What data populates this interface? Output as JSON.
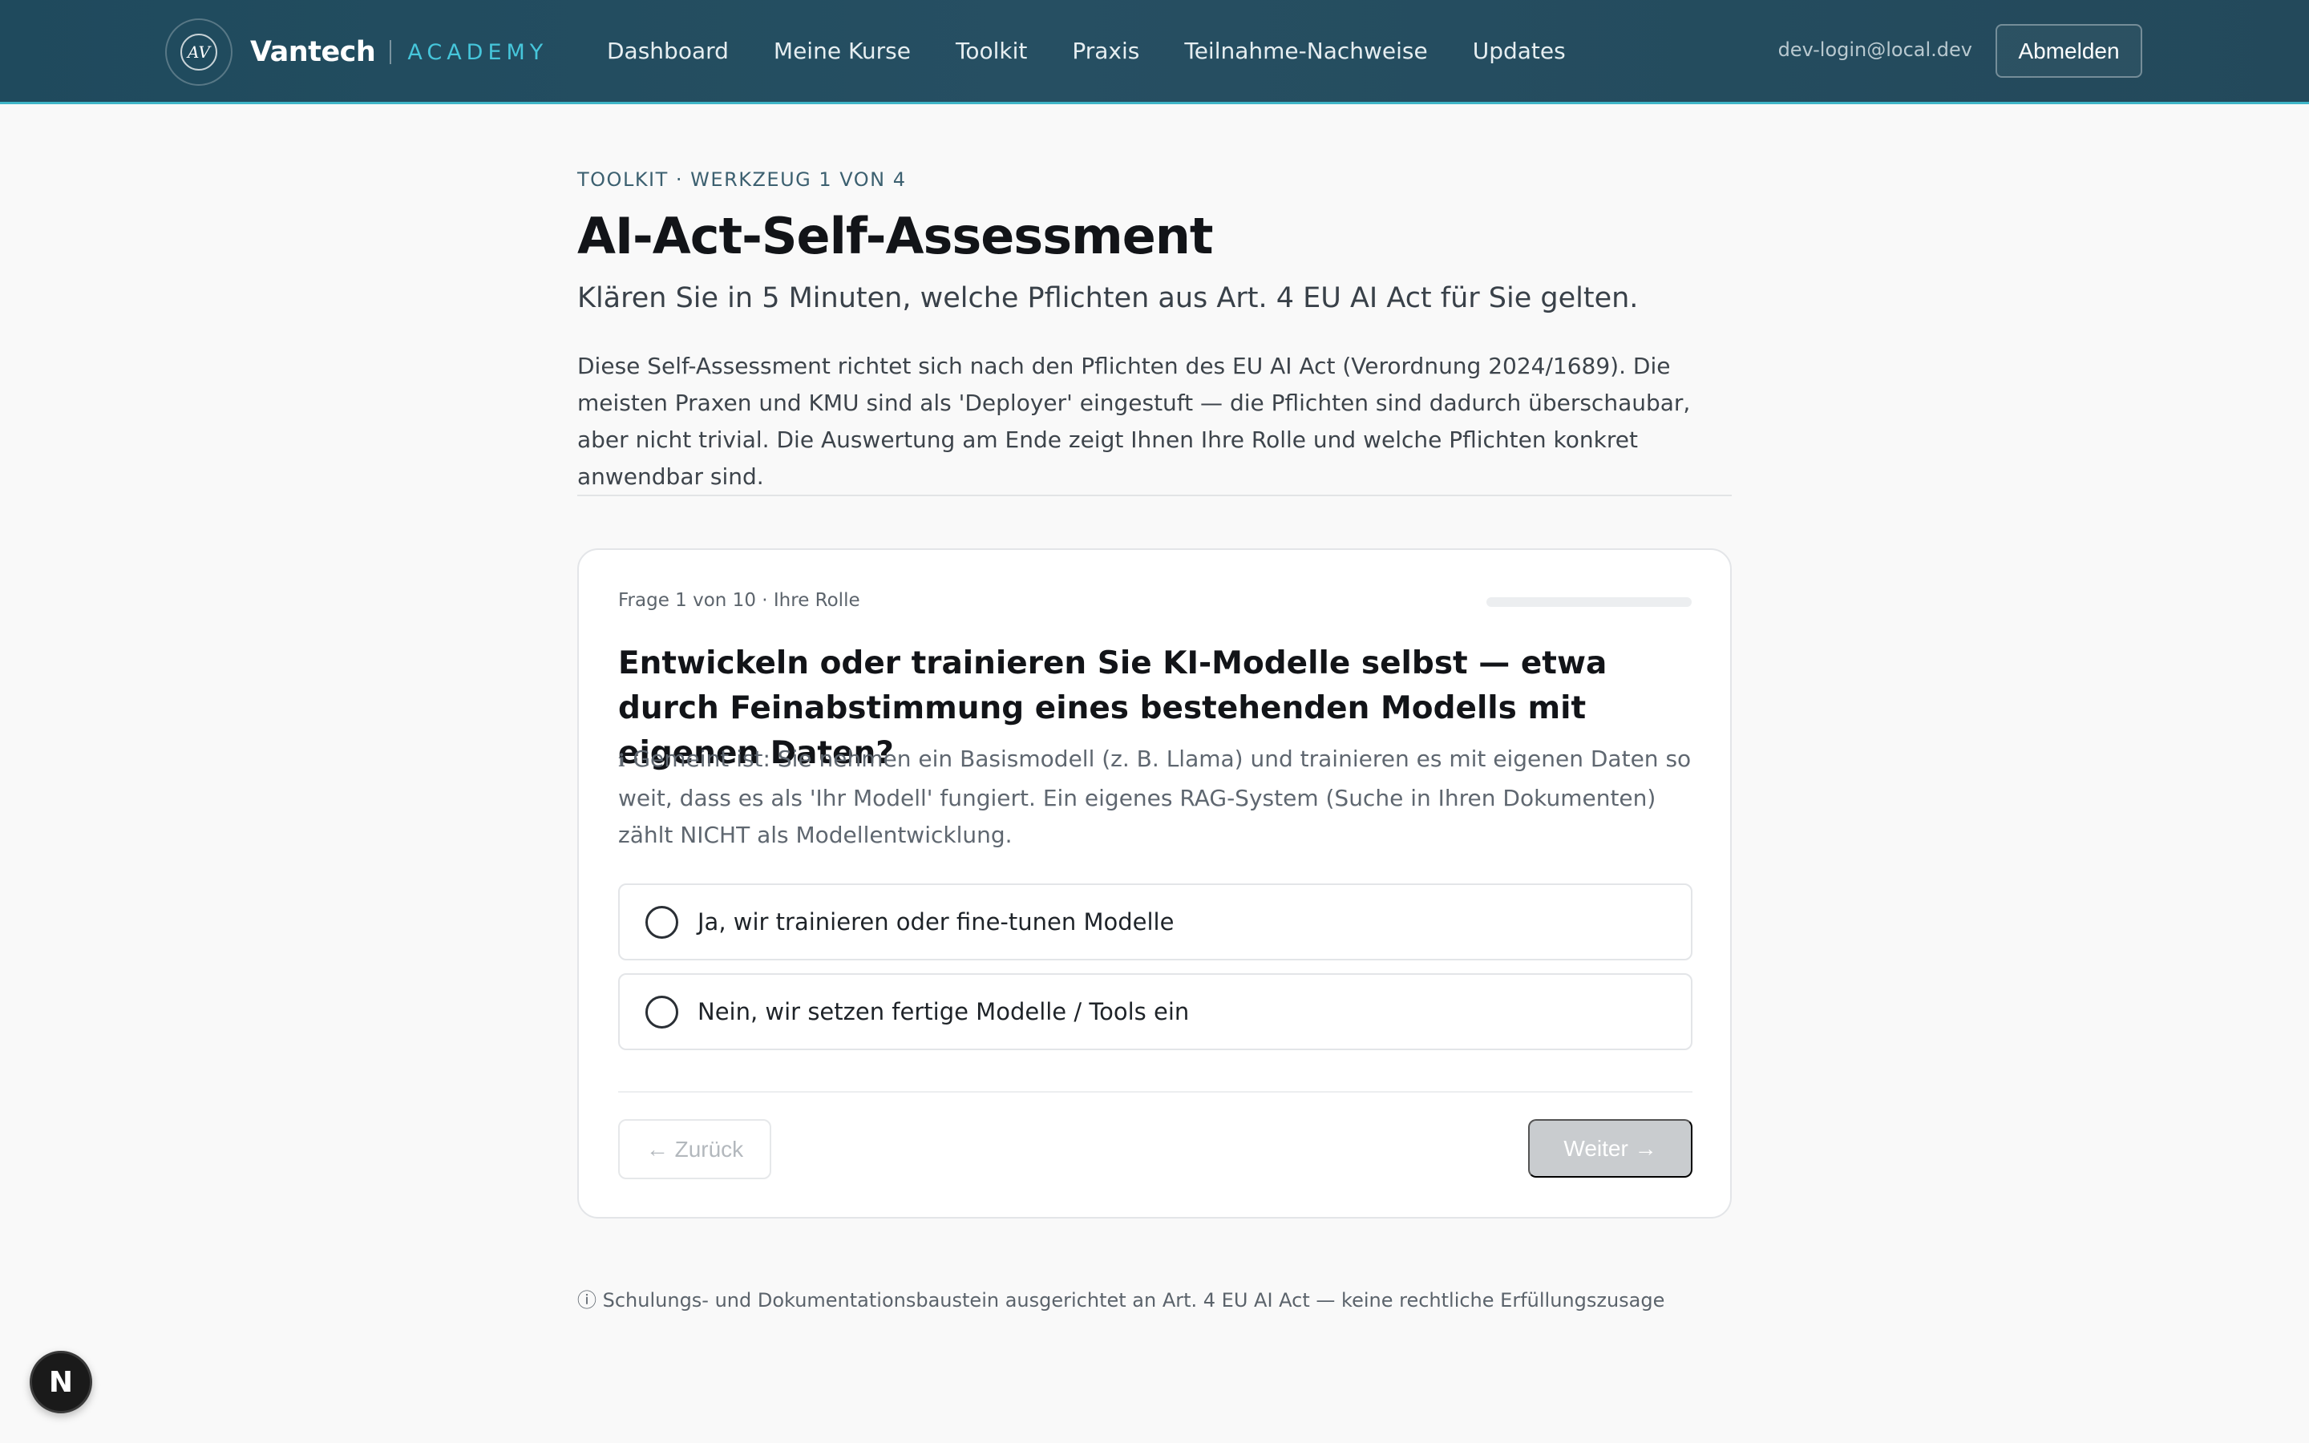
{
  "header": {
    "logo_text": "AV",
    "brand_name": "Vantech",
    "brand_sub": "ACADEMY",
    "nav": [
      {
        "label": "Dashboard"
      },
      {
        "label": "Meine Kurse"
      },
      {
        "label": "Toolkit"
      },
      {
        "label": "Praxis"
      },
      {
        "label": "Teilnahme-Nachweise"
      },
      {
        "label": "Updates"
      }
    ],
    "user_email": "dev-login@local.dev",
    "logout_label": "Abmelden"
  },
  "page": {
    "eyebrow": "TOOLKIT · WERKZEUG 1 VON 4",
    "title": "AI-Act-Self-Assessment",
    "subtitle": "Klären Sie in 5 Minuten, welche Pflichten aus Art. 4 EU AI Act für Sie gelten.",
    "intro": "Diese Self-Assessment richtet sich nach den Pflichten des EU AI Act (Verordnung 2024/1689). Die meisten Praxen und KMU sind als 'Deployer' eingestuft — die Pflichten sind dadurch überschaubar, aber nicht trivial. Die Auswertung am Ende zeigt Ihnen Ihre Rolle und welche Pflichten konkret anwendbar sind."
  },
  "question_card": {
    "meta": "Frage 1 von 10 · Ihre Rolle",
    "progress": 0.0,
    "question": "Entwickeln oder trainieren Sie KI-Modelle selbst — etwa durch Feinabstimmung eines bestehenden Modells mit eigenen Daten?",
    "hint_icon": "info-icon",
    "hint": "Gemeint ist: Sie nehmen ein Basismodell (z. B. Llama) und trainieren es mit eigenen Daten so weit, dass es als 'Ihr Modell' fungiert. Ein eigenes RAG-System (Suche in Ihren Dokumenten) zählt NICHT als Modellentwicklung.",
    "options": [
      {
        "label": "Ja, wir trainieren oder fine-tunen Modelle"
      },
      {
        "label": "Nein, wir setzen fertige Modelle / Tools ein"
      }
    ],
    "back_label": "← Zurück",
    "next_label": "Weiter →"
  },
  "footnote": "ⓘ Schulungs- und Dokumentationsbaustein ausgerichtet an Art. 4 EU AI Act — keine rechtliche Erfüllungszusage",
  "dev_badge": "N",
  "colors": {
    "header_bg": "#23495b",
    "accent": "#3fb6c8",
    "disabled_button": "#c9cccf"
  }
}
